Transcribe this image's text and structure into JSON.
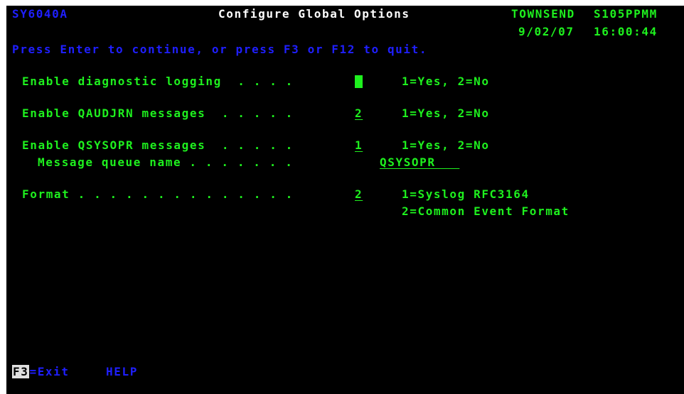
{
  "header": {
    "program_id": "SY6040A",
    "title": "Configure Global Options",
    "system_name": "TOWNSEND",
    "user_id": "S105PPMM",
    "date": "9/02/07",
    "time": "16:00:44"
  },
  "instructions": "Press Enter to continue, or press F3 or F12 to quit.",
  "options": {
    "diag": {
      "label": "Enable diagnostic logging  . . . .",
      "value": "",
      "hint": "1=Yes, 2=No"
    },
    "qaudjrn": {
      "label": "Enable QAUDJRN messages  . . . . .",
      "value": "2",
      "hint": "1=Yes, 2=No"
    },
    "qsysopr": {
      "label": "Enable QSYSOPR messages  . . . . .",
      "value": "1",
      "hint": "1=Yes, 2=No"
    },
    "msgq": {
      "label": "Message queue name . . . . . . .",
      "value": "QSYSOPR   "
    },
    "format": {
      "label": "Format . . . . . . . . . . . . . .",
      "value": "2",
      "hint1": "1=Syslog RFC3164",
      "hint2": "2=Common Event Format"
    }
  },
  "footer": {
    "f3_key": "F3",
    "f3_label": "=Exit",
    "help": "HELP"
  },
  "colors": {
    "background": "#000000",
    "text_green": "#1ef01e",
    "text_blue": "#1f1fff",
    "text_white": "#ffffff"
  }
}
